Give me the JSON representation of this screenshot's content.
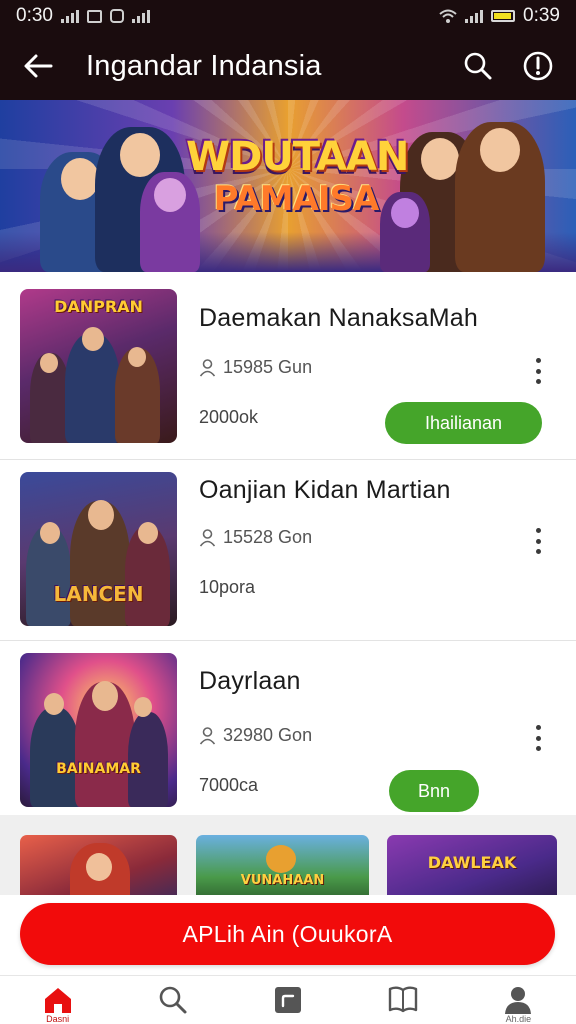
{
  "status_bar": {
    "time_left": "0:30",
    "time_right": "0:39"
  },
  "app_bar": {
    "title": "Ingandar Indansia"
  },
  "banner": {
    "title_line1": "WDUTAAN",
    "title_line2": "PAMAISA"
  },
  "items": [
    {
      "title": "Daemakan NanaksaMah",
      "meta": "15985 Gun",
      "price": "2000ok",
      "button_label": "Ihailianan",
      "thumb_logo": "DANPRAN"
    },
    {
      "title": "Oanjian Kidan Martian",
      "meta": "15528 Gon",
      "price": "10pora",
      "button_label": "",
      "thumb_logo": "LANCEN"
    },
    {
      "title": "Dayrlaan",
      "meta": "32980 Gon",
      "price": "7000ca",
      "button_label": "Bnn",
      "thumb_logo": "BAINAMAR"
    }
  ],
  "strip": {
    "tiles": [
      "",
      "VUNAHAAN",
      "DAWLEAK"
    ]
  },
  "cta": {
    "label": "APLih Ain (OuukorA"
  },
  "bottom_nav": {
    "home_label": "Dasni",
    "profile_label": "Ah.die"
  },
  "colors": {
    "bar_bg": "#1a0c0e",
    "accent_red": "#f20b0b",
    "accent_green": "#45a52a"
  }
}
